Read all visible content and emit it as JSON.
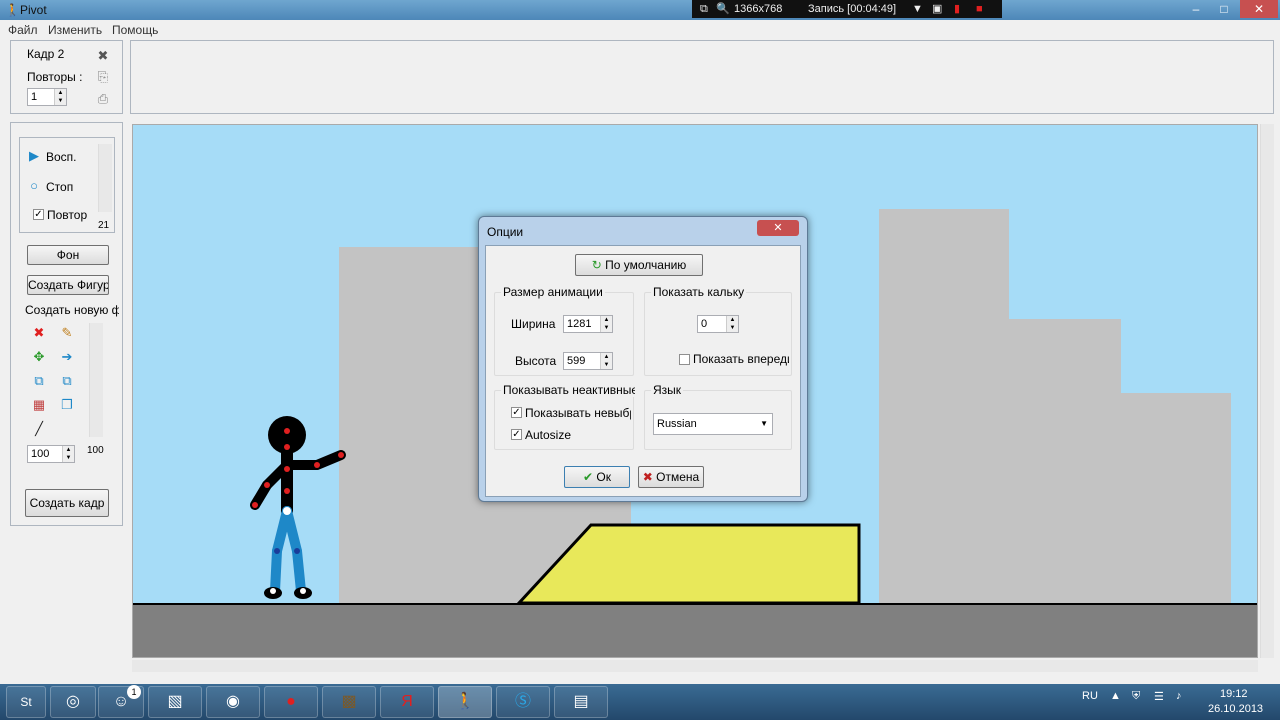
{
  "window": {
    "title": "Pivot",
    "app_icon": "stickman-icon"
  },
  "recorder": {
    "resolution": "1366x768",
    "recording": "Запись [00:04:49]"
  },
  "menu": {
    "file": "Файл",
    "edit": "Изменить",
    "help": "Помощь"
  },
  "frame_panel": {
    "frame_label": "Кадр 2",
    "repeats_label": "Повторы :",
    "repeats_value": "1"
  },
  "playback": {
    "play": "Восп.",
    "stop": "Стоп",
    "loop": "Повтор",
    "loop_checked": true,
    "scroll_value": "21"
  },
  "figures": {
    "background_button": "Фон",
    "create_figure_button": "Создать Фигуру",
    "create_new_label": "Создать новую ф",
    "scale_value": "100",
    "scroll_value": "100",
    "create_frame_button": "Создать кадр"
  },
  "dialog": {
    "title": "Опции",
    "defaults_button": "По умолчанию",
    "size_group": "Размер анимации",
    "width_label": "Ширина",
    "width_value": "1281",
    "height_label": "Высота",
    "height_value": "599",
    "onion_group": "Показать кальку",
    "onion_value": "0",
    "onion_front": "Показать впереди",
    "onion_front_checked": false,
    "inactive_group": "Показывать неактивные",
    "show_unselected": "Показывать невыбр",
    "show_unselected_checked": true,
    "autosize": "Autosize",
    "autosize_checked": true,
    "lang_group": "Язык",
    "language": "Russian",
    "ok": "Ок",
    "cancel": "Отмена"
  },
  "taskbar": {
    "start": "St",
    "badge": "1",
    "lang": "RU",
    "time": "19:12",
    "date": "26.10.2013"
  },
  "colors": {
    "sky": "#a6dcf7",
    "building": "#c3c3c3",
    "ground": "#808080",
    "ramp": "#e8e85a",
    "stick_body": "#000000",
    "stick_joint": "#e02020",
    "stick_legs": "#1e88c8"
  }
}
